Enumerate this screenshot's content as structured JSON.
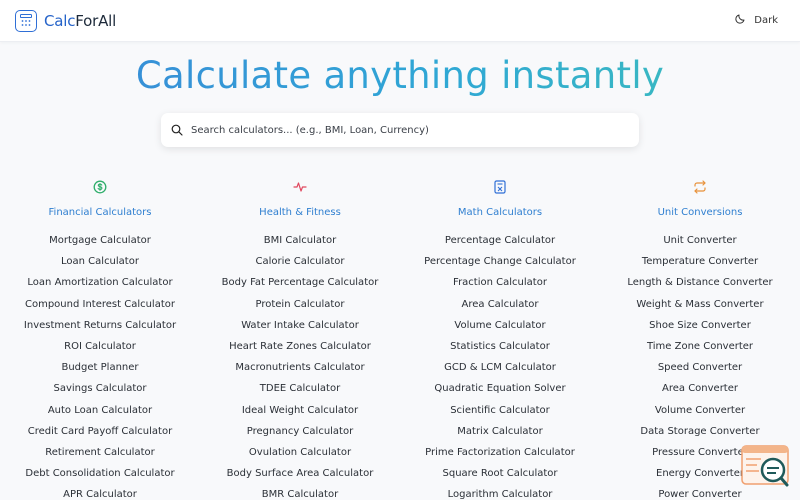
{
  "header": {
    "logo_part1": "Calc",
    "logo_part2": "ForAll",
    "theme_toggle_label": "Dark"
  },
  "hero": {
    "title": "Calculate anything instantly"
  },
  "search": {
    "placeholder": "Search calculators... (e.g., BMI, Loan, Currency)"
  },
  "categories": [
    {
      "title": "Financial Calculators",
      "icon": "dollar-circle-icon",
      "color": "#2fae6b",
      "items": [
        "Mortgage Calculator",
        "Loan Calculator",
        "Loan Amortization Calculator",
        "Compound Interest Calculator",
        "Investment Returns Calculator",
        "ROI Calculator",
        "Budget Planner",
        "Savings Calculator",
        "Auto Loan Calculator",
        "Credit Card Payoff Calculator",
        "Retirement Calculator",
        "Debt Consolidation Calculator",
        "APR Calculator"
      ]
    },
    {
      "title": "Health & Fitness",
      "icon": "heartbeat-icon",
      "color": "#e0475e",
      "items": [
        "BMI Calculator",
        "Calorie Calculator",
        "Body Fat Percentage Calculator",
        "Protein Calculator",
        "Water Intake Calculator",
        "Heart Rate Zones Calculator",
        "Macronutrients Calculator",
        "TDEE Calculator",
        "Ideal Weight Calculator",
        "Pregnancy Calculator",
        "Ovulation Calculator",
        "Body Surface Area Calculator",
        "BMR Calculator"
      ]
    },
    {
      "title": "Math Calculators",
      "icon": "calculator-icon",
      "color": "#2f6fd6",
      "items": [
        "Percentage Calculator",
        "Percentage Change Calculator",
        "Fraction Calculator",
        "Area Calculator",
        "Volume Calculator",
        "Statistics Calculator",
        "GCD & LCM Calculator",
        "Quadratic Equation Solver",
        "Scientific Calculator",
        "Matrix Calculator",
        "Prime Factorization Calculator",
        "Square Root Calculator",
        "Logarithm Calculator"
      ]
    },
    {
      "title": "Unit Conversions",
      "icon": "swap-arrows-icon",
      "color": "#e8923a",
      "items": [
        "Unit Converter",
        "Temperature Converter",
        "Length & Distance Converter",
        "Weight & Mass Converter",
        "Shoe Size Converter",
        "Time Zone Converter",
        "Speed Converter",
        "Area Converter",
        "Volume Converter",
        "Data Storage Converter",
        "Pressure Converter",
        "Energy Converter",
        "Power Converter"
      ]
    }
  ]
}
